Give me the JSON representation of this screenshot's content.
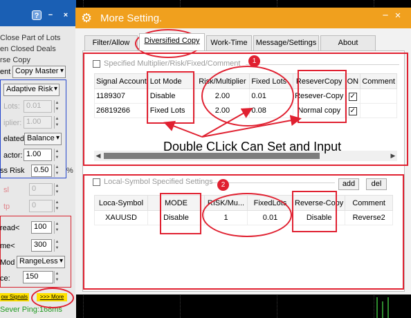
{
  "left_panel": {
    "lines": [
      "Close Part of Lots",
      "en Closed Deals",
      "rse Copy"
    ],
    "mode_label": "ent",
    "mode_value": "Copy Master",
    "risk_select": "Adaptive Risk",
    "lots_label": "Lots:",
    "lots_value": "0.01",
    "multiplier_label": "iplier:",
    "multiplier_value": "1.00",
    "related_label": "elated:",
    "related_value": "Balance",
    "factor_label": "actor:",
    "factor_value": "1.00",
    "less_risk_label": "ss Risk",
    "less_risk_value": "0.50",
    "less_risk_unit": "%",
    "sl_label": "sl",
    "sl_value": "0",
    "tp_label": "tp",
    "tp_value": "0",
    "spread_label": "read<",
    "spread_value": "100",
    "time_label": "me<",
    "time_value": "300",
    "mod_label": "Mod",
    "mod_value": "RangeLess",
    "ce_label": "ce:",
    "ce_value": "150",
    "show_signals_button": "ow Signals",
    "more_button": ">>> More",
    "ping": "Sever Ping:168ms"
  },
  "window": {
    "title": "More Setting.",
    "help": "?",
    "minimize": "−",
    "close": "×",
    "panel_minimize": "−",
    "panel_close": "×"
  },
  "tabs": [
    "Filter/Allow",
    "Diversified Copy",
    "Work-Time",
    "Message/Settings",
    "About"
  ],
  "section1": {
    "title": "Specified Multiplier/Risk/Fixed/Comment",
    "badge": "1",
    "columns": [
      "Signal Account",
      "Lot Mode",
      "Risk/Multiplier",
      "Fixed Lots",
      "ReseverCopy",
      "ON",
      "Comment"
    ],
    "rows": [
      {
        "account": "1189307",
        "lot_mode": "Disable",
        "risk": "2.00",
        "fixed_lots": "0.01",
        "resever": "Resever-Copy",
        "on": "✓",
        "comment": ""
      },
      {
        "account": "26819266",
        "lot_mode": "Fixed Lots",
        "risk": "2.00",
        "fixed_lots": "0.08",
        "resever": "Normal copy",
        "on": "✓",
        "comment": ""
      }
    ]
  },
  "section2": {
    "title": "Local-Symbol Specified Settings",
    "badge": "2",
    "add_button": "add",
    "del_button": "del",
    "columns": [
      "Loca-Symbol",
      "MODE",
      "RISK/Mu...",
      "FixedLots",
      "Reverse-Copy",
      "Comment"
    ],
    "rows": [
      {
        "symbol": "XAUUSD",
        "mode": "Disable",
        "risk": "1",
        "fixed": "0.01",
        "reverse": "Disable",
        "comment": "Reverse2"
      }
    ]
  },
  "annotation": {
    "text": "Double CLick Can Set and Input"
  },
  "colors": {
    "title_orange": "#f0a01e",
    "panel_blue": "#1a5fb4",
    "annotation_red": "#e02030",
    "button_yellow": "#ffe100",
    "ping_green": "#1f9a1f"
  }
}
